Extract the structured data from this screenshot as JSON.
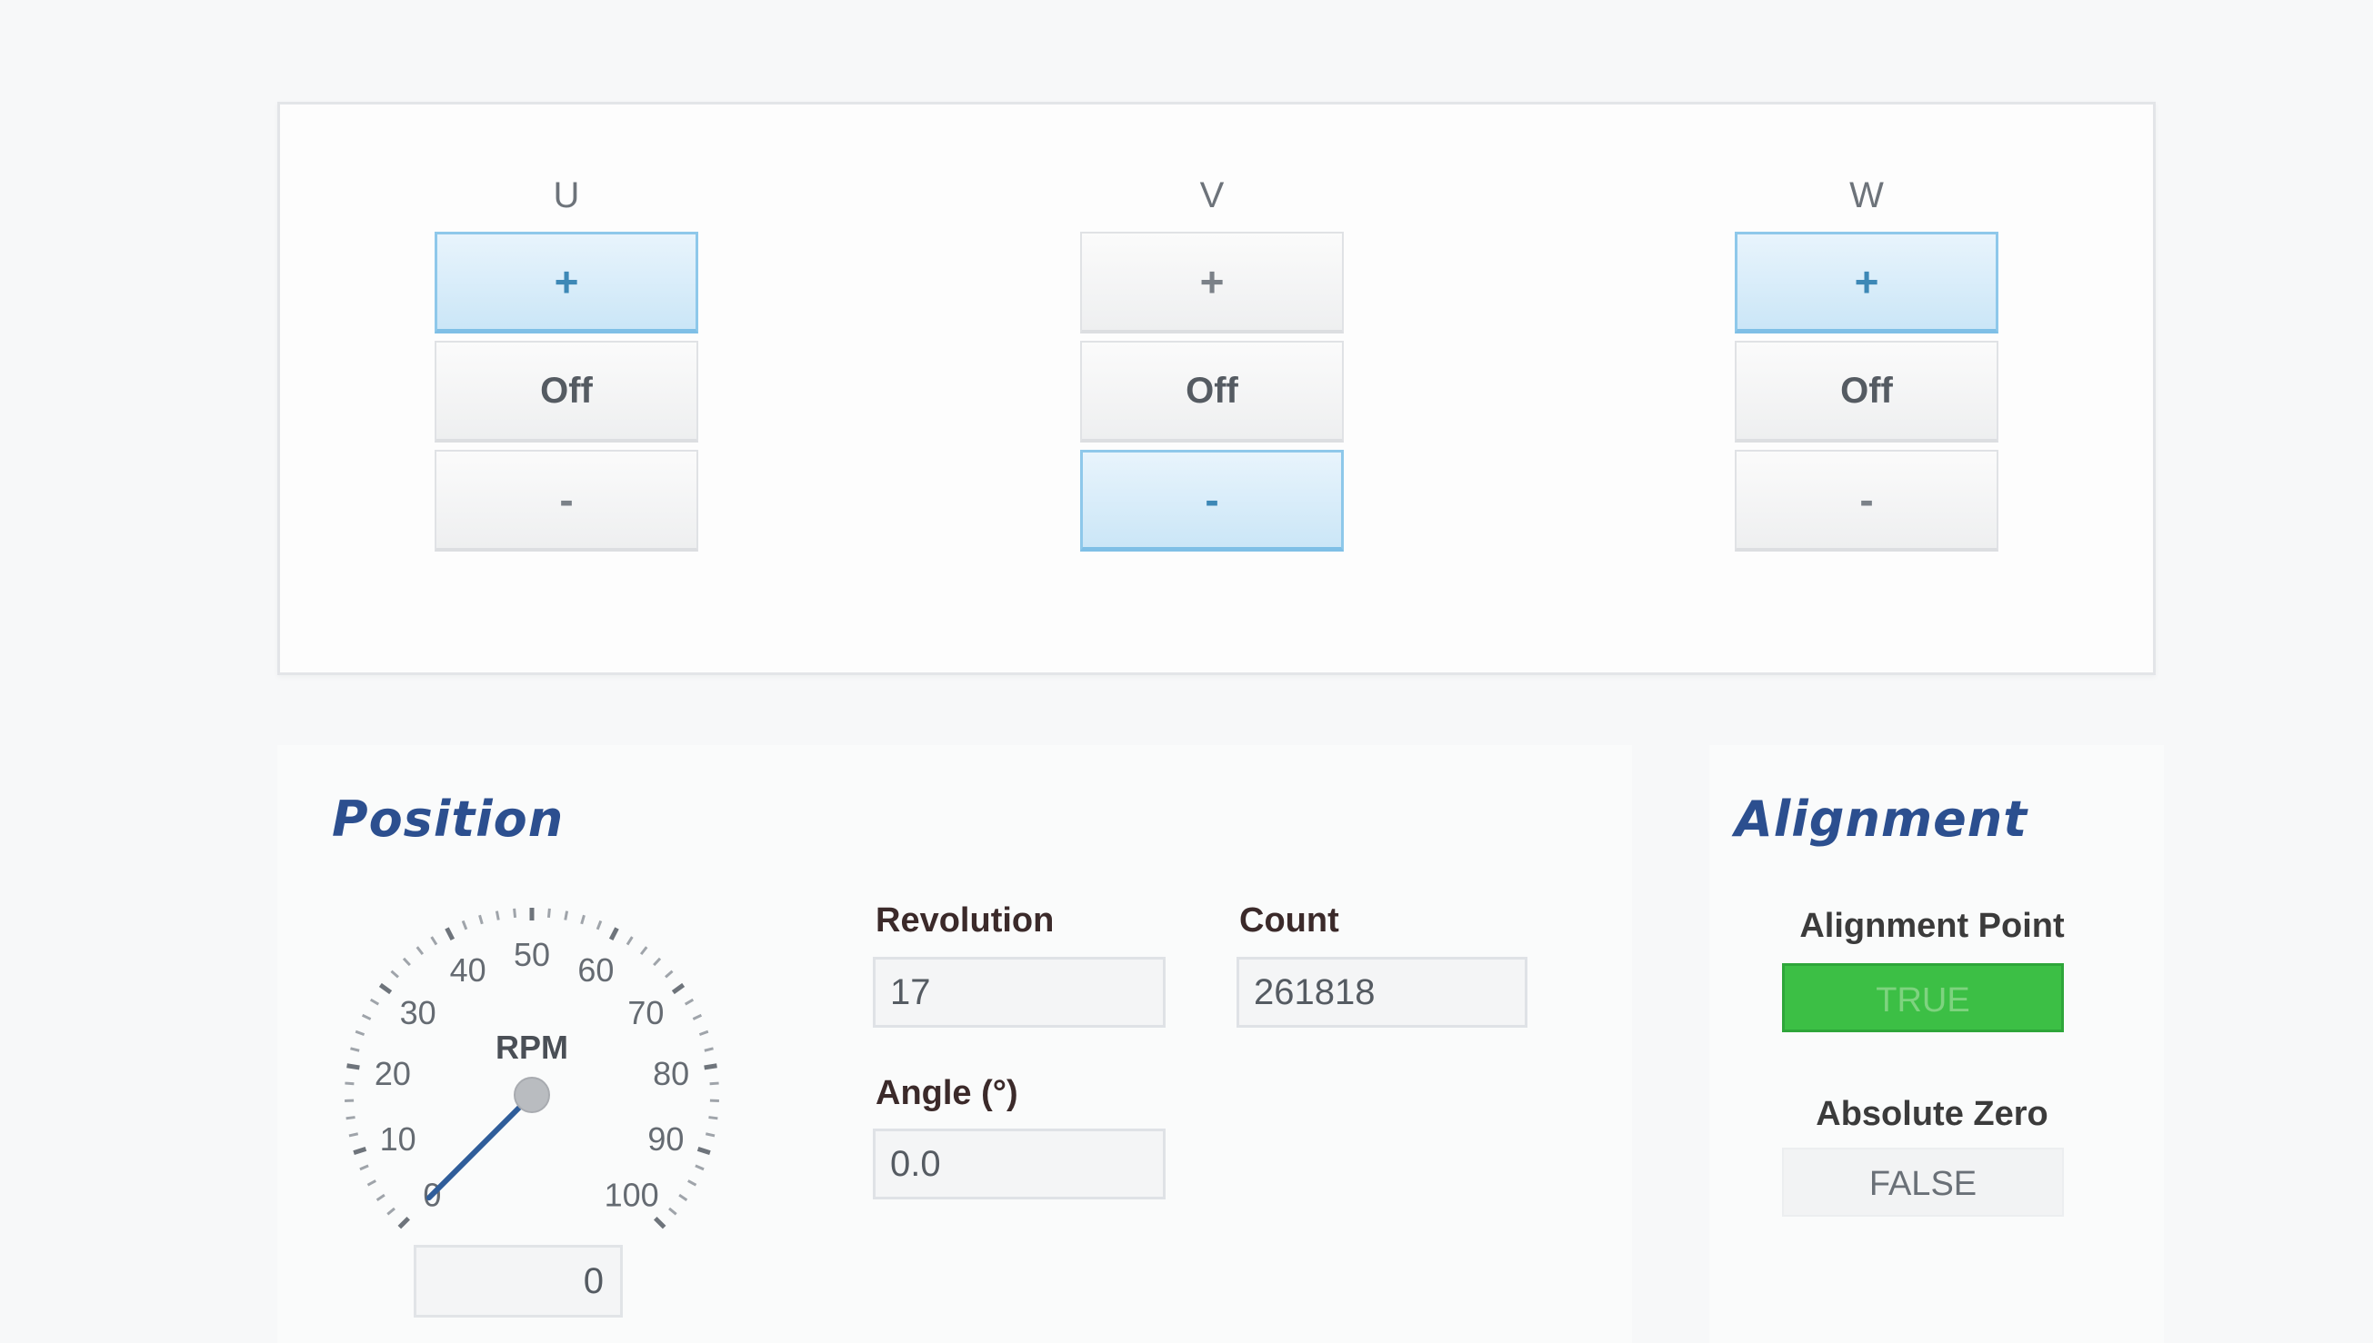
{
  "phases": [
    {
      "label": "U",
      "plus": "+",
      "off": "Off",
      "minus": "-",
      "active": "plus"
    },
    {
      "label": "V",
      "plus": "+",
      "off": "Off",
      "minus": "-",
      "active": "minus"
    },
    {
      "label": "W",
      "plus": "+",
      "off": "Off",
      "minus": "-",
      "active": "plus"
    }
  ],
  "position": {
    "title": "Position",
    "revolution_label": "Revolution",
    "revolution_value": "17",
    "count_label": "Count",
    "count_value": "261818",
    "angle_label": "Angle (°)",
    "angle_value": "0.0",
    "gauge": {
      "label": "RPM",
      "ticks": [
        "0",
        "10",
        "20",
        "30",
        "40",
        "50",
        "60",
        "70",
        "80",
        "90",
        "100"
      ],
      "min": 0,
      "max": 100,
      "value": 0,
      "rpm_value": "0"
    }
  },
  "alignment": {
    "title": "Alignment",
    "point_label": "Alignment Point",
    "point_value": "TRUE",
    "zero_label": "Absolute Zero",
    "zero_value": "FALSE"
  },
  "colors": {
    "active_button": "#cbe6f7",
    "title": "#2c4f8f",
    "indicator_on": "#3cbf45",
    "needle": "#2f5d9a"
  }
}
